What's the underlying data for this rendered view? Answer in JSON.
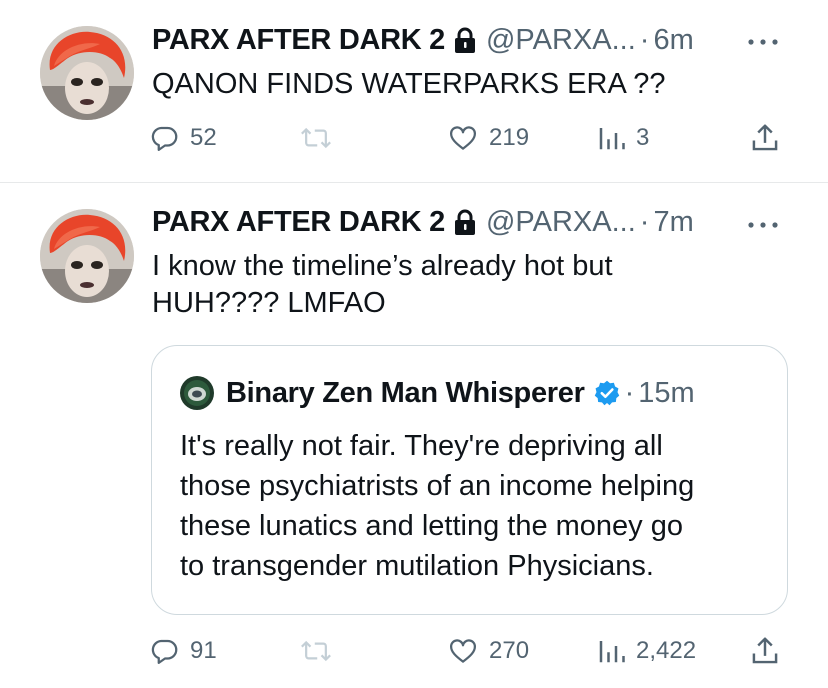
{
  "tweets": [
    {
      "display_name": "PARX AFTER DARK 2",
      "handle": "@PARXA...",
      "dot": "·",
      "time": "6m",
      "text": "QANON FINDS WATERPARKS ERA ??",
      "replies": "52",
      "retweets": "",
      "likes": "219",
      "views": "3"
    },
    {
      "display_name": "PARX AFTER DARK 2",
      "handle": "@PARXA...",
      "dot": "·",
      "time": "7m",
      "text_line1": "I know the timeline’s already hot but",
      "text_line2": "HUH???? LMFAO",
      "replies": "91",
      "retweets": "",
      "likes": "270",
      "views": "2,422",
      "quote": {
        "display_name": "Binary Zen Man Whisperer",
        "dot": "·",
        "time": "15m",
        "lines": [
          "It's really not fair. They're depriving all",
          "those psychiatrists of an income helping",
          "these lunatics and letting the money go",
          "to transgender mutilation Physicians."
        ]
      }
    }
  ],
  "icons": {
    "reply": "reply-icon",
    "retweet": "retweet-icon",
    "like": "heart-icon",
    "views": "views-icon",
    "share": "share-icon",
    "lock": "lock-icon",
    "verified": "verified-badge-icon",
    "more": "more-icon"
  },
  "colors": {
    "text": "#0f1419",
    "secondary": "#536471",
    "border": "#e7e9ea",
    "verified": "#1d9bf0",
    "avatar_hair": "#e8452a"
  }
}
